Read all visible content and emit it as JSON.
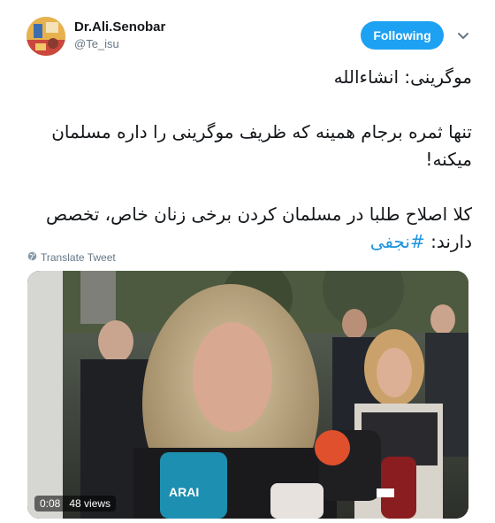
{
  "user": {
    "display_name": "Dr.Ali.Senobar",
    "handle": "@Te_isu"
  },
  "actions": {
    "follow_label": "Following"
  },
  "tweet": {
    "line1": "موگرینی: انشاءالله",
    "line2": "تنها ثمره برجام همینه که ظریف موگرینی را داره مسلمان میکنه!",
    "line3_text": "کلا اصلاح طلبا در مسلمان کردن برخی زنان خاص، تخصص دارند: ",
    "hashtag": "#نجفی"
  },
  "translate_label": "Translate Tweet",
  "video": {
    "time": "0:08",
    "views": "48 views"
  },
  "icons": {
    "caret": "chevron-down-icon",
    "globe": "globe-icon"
  },
  "colors": {
    "accent": "#1da1f2",
    "hashtag": "#1b95e0",
    "muted": "#657786"
  }
}
